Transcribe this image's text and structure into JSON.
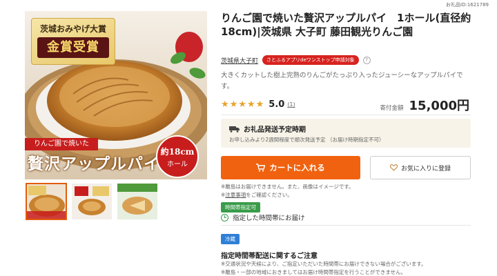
{
  "item_id": "お礼品ID:1621789",
  "gallery": {
    "badge_top": "茨城おみやげ大賞",
    "badge_main": "金賞受賞",
    "caption_red": "りんご園で焼いた",
    "caption_big": "贅沢アップルパイ",
    "size_top": "約18cm",
    "size_bottom": "ホール"
  },
  "product": {
    "title": "りんご園で焼いた贅沢アップルパイ　1ホール(直径約18cm)|茨城県 大子町 藤田観光りんご園",
    "shop_name": "茨城県大子町",
    "shop_badge": "さとふるアプリdeワンストップ申請対象",
    "help": "?",
    "description": "大きくカットした樹上完熟のりんごがたっぷり入ったジューシーなアップルパイです。",
    "stars": "★★★★★",
    "rating": "5.0",
    "review_count": "(1)",
    "price_label": "寄付金額",
    "price": "15,000円"
  },
  "shipping": {
    "heading": "お礼品発送予定時期",
    "detail": "お申し込みより2週間程度で順次発送予定 （お届け時期指定不可）"
  },
  "actions": {
    "cart_label": "カートに入れる",
    "favorite_label": "お気に入りに登録"
  },
  "notes": {
    "line1": "※離島はお届けできません。また、画像はイメージです。",
    "line2_prefix": "※",
    "line2_link": "注意事項",
    "line2_suffix": "をご確認ください。"
  },
  "delivery": {
    "tag": "時間帯指定可",
    "text": "指定した時間帯にお届け"
  },
  "storage": {
    "tag": "冷蔵"
  },
  "notice": {
    "title": "指定時間帯配送に関するご注意",
    "line1": "※交通状況や天候により、ご指定いただいた時間帯にお届けできない場合がございます。",
    "line2": "※離島・一部の地域におきましてはお届け時間帯指定を行うことができません。"
  },
  "colors": {
    "accent_orange": "#f0620f",
    "badge_red": "#d7231f",
    "star": "#e8a22a",
    "green_tag": "#3a9c4a",
    "blue_tag": "#2f7fd6"
  }
}
